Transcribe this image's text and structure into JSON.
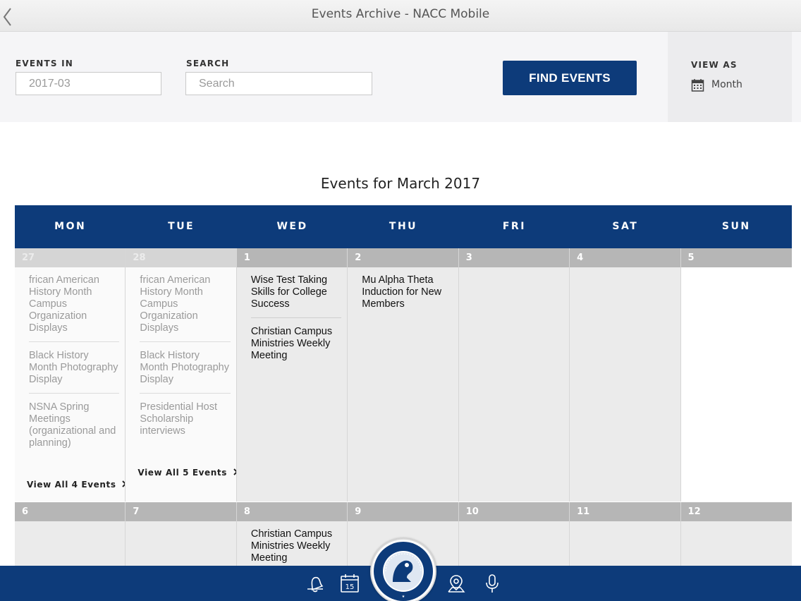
{
  "app": {
    "title": "Events Archive - NACC Mobile",
    "back_icon": "chevron-left-icon"
  },
  "filters": {
    "events_in_label": "EVENTS IN",
    "events_in_value": "2017-03",
    "search_label": "SEARCH",
    "search_placeholder": "Search",
    "find_button": "FIND EVENTS",
    "view_as_label": "VIEW AS",
    "view_as_value": "Month",
    "view_as_icon": "calendar-icon"
  },
  "calendar": {
    "title": "Events for March 2017",
    "days_of_week": [
      "MON",
      "TUE",
      "WED",
      "THU",
      "FRI",
      "SAT",
      "SUN"
    ],
    "weeks": [
      {
        "days": [
          {
            "number": "27",
            "past": true,
            "events": [
              "frican American History Month Campus Organization Displays",
              "Black History Month Photography Display",
              "NSNA Spring Meetings (organizational and planning)"
            ],
            "view_all": "View All 4 Events"
          },
          {
            "number": "28",
            "past": true,
            "events": [
              "frican American History Month Campus Organization Displays",
              "Black History Month Photography Display",
              "Presidential Host Scholarship interviews"
            ],
            "view_all": "View All 5 Events"
          },
          {
            "number": "1",
            "events": [
              "Wise Test Taking Skills for College Success",
              "Christian Campus Ministries Weekly Meeting"
            ]
          },
          {
            "number": "2",
            "events": [
              "Mu Alpha Theta Induction for New Members"
            ]
          },
          {
            "number": "3",
            "events": []
          },
          {
            "number": "4",
            "events": []
          },
          {
            "number": "5",
            "events": [],
            "white": true
          }
        ]
      },
      {
        "days": [
          {
            "number": "6",
            "events": []
          },
          {
            "number": "7",
            "events": []
          },
          {
            "number": "8",
            "events": [
              "Christian Campus Ministries Weekly Meeting"
            ]
          },
          {
            "number": "9",
            "events": []
          },
          {
            "number": "10",
            "events": []
          },
          {
            "number": "11",
            "events": []
          },
          {
            "number": "12",
            "events": []
          }
        ]
      }
    ]
  },
  "tabbar": {
    "items": [
      "bell-icon",
      "calendar-15-icon",
      "college-logo",
      "map-pin-icon",
      "microphone-icon"
    ],
    "calendar_day": "15"
  },
  "colors": {
    "brand_blue": "#0d3b7a",
    "day_header_gray": "#b6b6b6"
  }
}
